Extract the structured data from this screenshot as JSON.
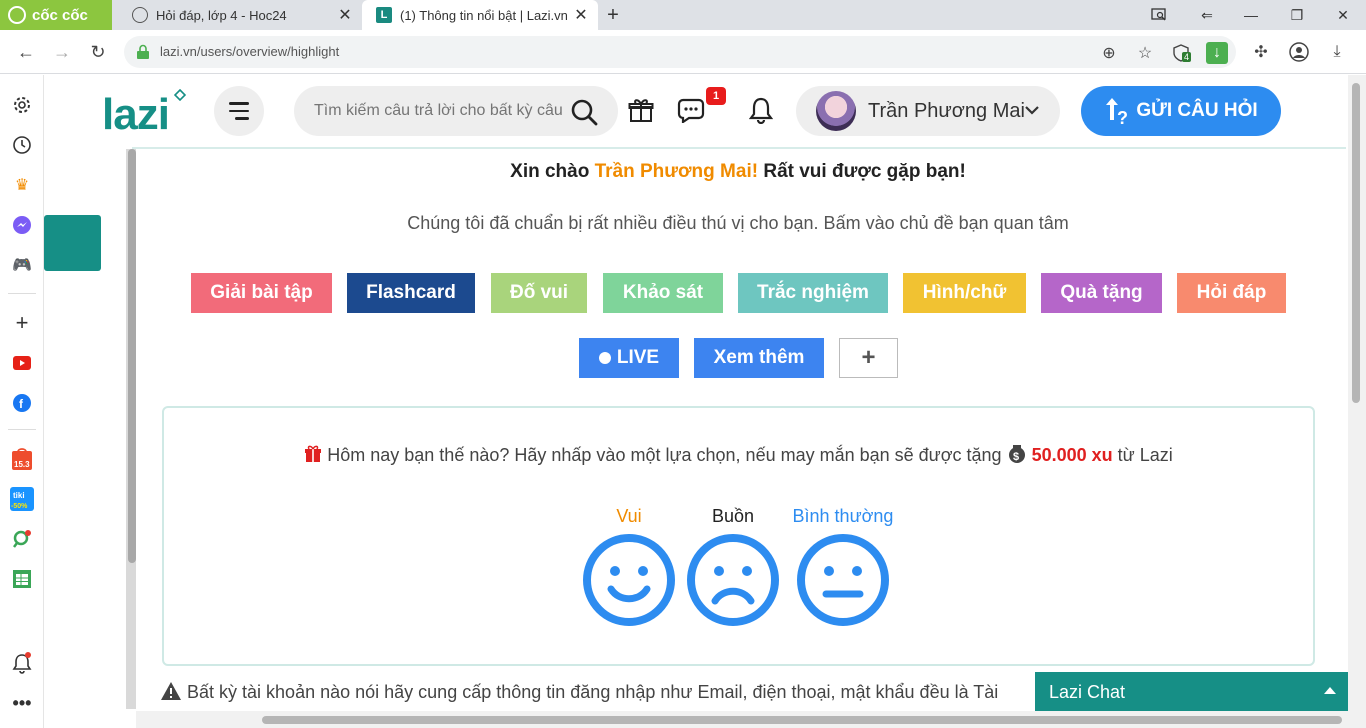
{
  "browser": {
    "brand": "cốc cốc",
    "tabs": [
      {
        "title": "Hỏi đáp, lớp 4 - Hoc24",
        "active": false
      },
      {
        "title": "(1) Thông tin nổi bật | Lazi.vn",
        "active": true
      }
    ],
    "url": "lazi.vn/users/overview/highlight",
    "extension_badge": "4"
  },
  "header": {
    "logo": "lazi",
    "search_placeholder": "Tìm kiếm câu trả lời cho bất kỳ câu hỏi nào",
    "messages_badge": "1",
    "user_name": "Trần Phương Mai",
    "ask_button": "GỬI CÂU HỎI"
  },
  "greeting": {
    "prefix": "Xin chào",
    "name": "Trần Phương Mai!",
    "suffix": "Rất vui được gặp bạn!",
    "subtitle": "Chúng tôi đã chuẩn bị rất nhiều điều thú vị cho bạn. Bấm vào chủ đề bạn quan tâm"
  },
  "categories": [
    {
      "label": "Giải bài tập",
      "color": "#f26b7a"
    },
    {
      "label": "Flashcard",
      "color": "#1c4a8f"
    },
    {
      "label": "Đố vui",
      "color": "#a9d47c"
    },
    {
      "label": "Khảo sát",
      "color": "#7fd49a"
    },
    {
      "label": "Trắc nghiệm",
      "color": "#6ec6c0"
    },
    {
      "label": "Hình/chữ",
      "color": "#f1c232"
    },
    {
      "label": "Quà tặng",
      "color": "#b566c9"
    },
    {
      "label": "Hỏi đáp",
      "color": "#f88a6e"
    }
  ],
  "secondary": [
    {
      "label": "LIVE",
      "color": "#3d84f0"
    },
    {
      "label": "Xem thêm",
      "color": "#3d84f0"
    }
  ],
  "mood": {
    "question": "Hôm nay bạn thế nào? Hãy nhấp vào một lựa chọn, nếu may mắn bạn sẽ được tặng",
    "amount": "50.000 xu",
    "from": "từ Lazi",
    "options": [
      {
        "label": "Vui",
        "color": "#f08b00"
      },
      {
        "label": "Buồn",
        "color": "#222222"
      },
      {
        "label": "Bình thường",
        "color": "#2d8cf0"
      }
    ],
    "face_color": "#2d8cf0"
  },
  "warning": "Bất kỳ tài khoản nào nói hãy cung cấp thông tin đăng nhập như Email, điện thoại, mật khẩu đều là Tài",
  "chat": {
    "label": "Lazi Chat"
  },
  "colors": {
    "brand": "#168f86",
    "primary": "#2d8cf0",
    "accent_orange": "#f08b00"
  }
}
